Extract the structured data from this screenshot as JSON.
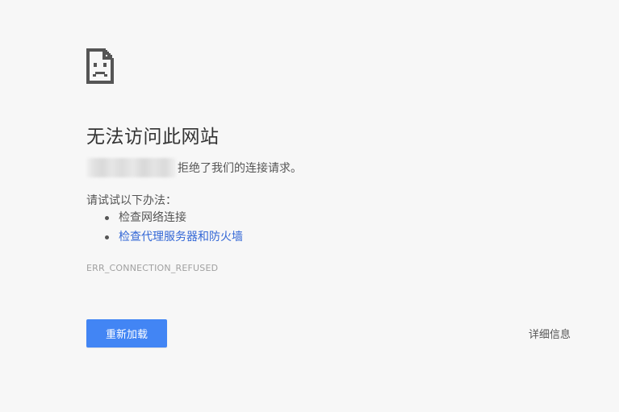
{
  "page": {
    "title": "无法访问此网站",
    "refused_message": "拒绝了我们的连接请求。",
    "suggestions_heading": "请试试以下办法：",
    "suggestions": [
      {
        "label": "检查网络连接",
        "is_link": false
      },
      {
        "label": "检查代理服务器和防火墙",
        "is_link": true
      }
    ],
    "error_code": "ERR_CONNECTION_REFUSED",
    "reload_label": "重新加载",
    "details_label": "详细信息"
  },
  "icons": {
    "error": "sad-document-icon"
  },
  "colors": {
    "background": "#f7f7f7",
    "primary_button": "#4285f4",
    "link": "#3367d6",
    "text": "#333333",
    "muted_text": "#a0a0a0"
  }
}
